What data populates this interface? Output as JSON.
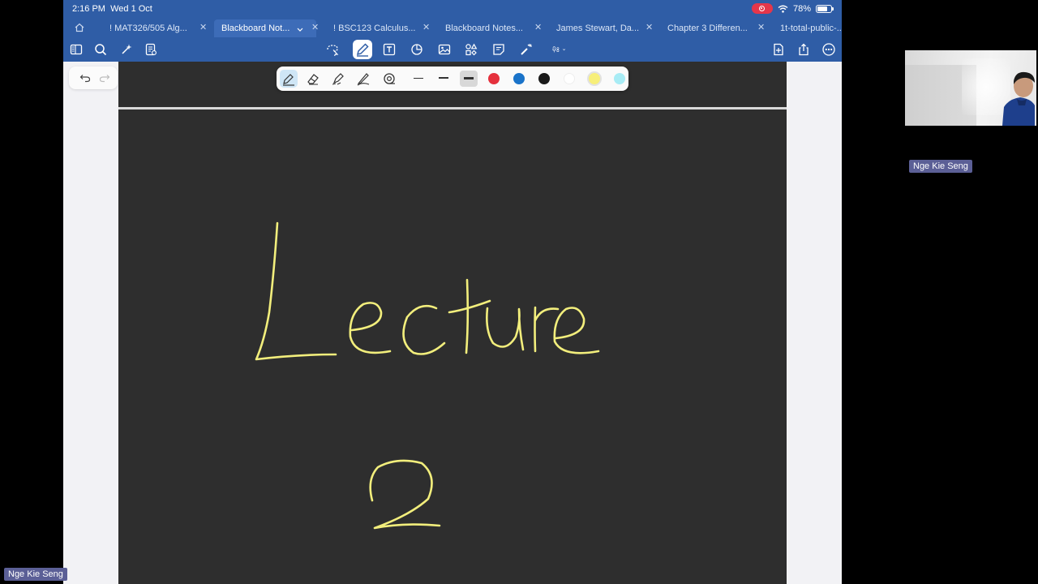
{
  "status_bar": {
    "time": "2:16 PM",
    "date": "Wed 1 Oct",
    "battery": "78%",
    "battery_level": 0.78
  },
  "tabs": [
    {
      "label": "! MAT326/505 Alg...",
      "active": false
    },
    {
      "label": "Blackboard Not...",
      "active": true
    },
    {
      "label": "! BSC123 Calculus...",
      "active": false
    },
    {
      "label": "Blackboard Notes...",
      "active": false
    },
    {
      "label": "James Stewart, Da...",
      "active": false
    },
    {
      "label": "Chapter 3 Differen...",
      "active": false
    },
    {
      "label": "1t-total-public-...",
      "active": false
    }
  ],
  "pen_toolbar": {
    "colors": [
      "#e5313d",
      "#1a73c9",
      "#1a1a1a",
      "#ffffff",
      "#f7ef7a",
      "#a8ecf5"
    ]
  },
  "handwriting": {
    "ink_color": "#f2ee7c",
    "words": [
      "Lecture",
      "2"
    ]
  },
  "participants": [
    {
      "name": "Nge Kie Seng"
    },
    {
      "name": "Nge Kie Seng"
    }
  ],
  "colors": {
    "app_bar": "#2f5da6",
    "page_background": "#2e2e2e",
    "name_tag": "#5b5f96"
  }
}
